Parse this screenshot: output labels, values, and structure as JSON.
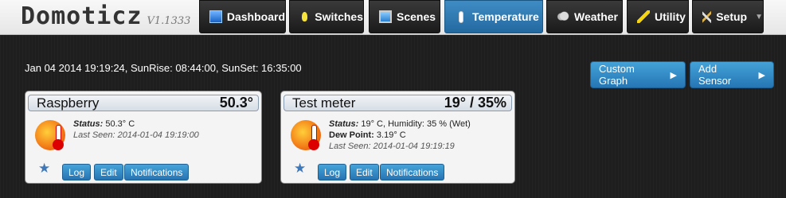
{
  "app": {
    "name": "Domoticz",
    "version": "V1.1333"
  },
  "nav": [
    {
      "label": "Dashboard",
      "icon": "dashboard-icon"
    },
    {
      "label": "Switches",
      "icon": "bulb-icon"
    },
    {
      "label": "Scenes",
      "icon": "scenes-icon"
    },
    {
      "label": "Temperature",
      "icon": "thermometer-icon",
      "active": true
    },
    {
      "label": "Weather",
      "icon": "weather-icon"
    },
    {
      "label": "Utility",
      "icon": "utility-icon"
    },
    {
      "label": "Setup",
      "icon": "setup-icon",
      "dropdown": true
    }
  ],
  "status_line": "Jan 04 2014 19:19:24, SunRise: 08:44:00, SunSet: 16:35:00",
  "actions": {
    "custom_graph": "Custom Graph",
    "add_sensor": "Add Sensor"
  },
  "devices": [
    {
      "name": "Raspberry",
      "value": "50.3°",
      "status_label": "Status:",
      "status": "50.3° C",
      "last_seen_label": "Last Seen:",
      "last_seen": "2014-01-04 19:19:00",
      "buttons": {
        "log": "Log",
        "edit": "Edit",
        "notifications": "Notifications"
      }
    },
    {
      "name": "Test meter",
      "value": "19° / 35%",
      "status_label": "Status:",
      "status": "19° C, Humidity: 35 % (Wet)",
      "dew_label": "Dew Point:",
      "dew": "3.19° C",
      "last_seen_label": "Last Seen:",
      "last_seen": "2014-01-04 19:19:19",
      "buttons": {
        "log": "Log",
        "edit": "Edit",
        "notifications": "Notifications"
      }
    }
  ],
  "colors": {
    "accent": "#2f7fbd",
    "active_tab": "#2e7ab6",
    "background": "#1e1e1e"
  }
}
